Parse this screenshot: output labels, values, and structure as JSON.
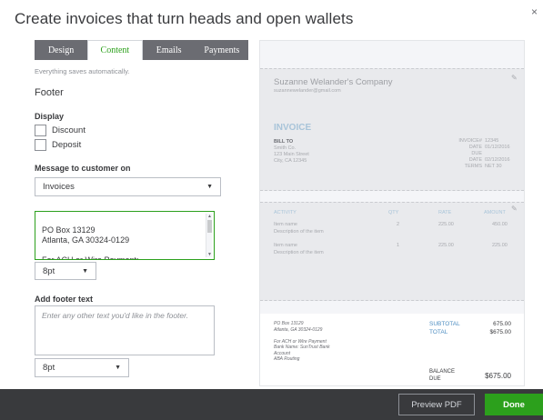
{
  "page_title": "Create invoices that turn heads and open wallets",
  "close_glyph": "×",
  "tabs": [
    {
      "label": "Design"
    },
    {
      "label": "Content"
    },
    {
      "label": "Emails"
    },
    {
      "label": "Payments"
    }
  ],
  "autosave_note": "Everything saves automatically.",
  "section_title": "Footer",
  "display": {
    "label": "Display",
    "options": [
      {
        "label": "Discount",
        "checked": false
      },
      {
        "label": "Deposit",
        "checked": false
      }
    ]
  },
  "message": {
    "label": "Message to customer on",
    "selected": "Invoices",
    "text": "PO Box 13129\nAtlanta, GA 30324-0129\n\nFor ACH or Wire Payment:\nBank Name: SunTrust Bank",
    "font_size": "8pt"
  },
  "footer": {
    "label": "Add footer text",
    "placeholder": "Enter any other text you'd like in the footer.",
    "font_size": "8pt"
  },
  "preview": {
    "company_name": "Suzanne Welander's Company",
    "company_email": "suzannewelander@gmail.com",
    "invoice_title": "INVOICE",
    "bill_to_label": "BILL TO",
    "bill_to_address": "Smith Co.\n123 Main Street\nCity, CA 12345",
    "meta_labels": "INVOICE#\nDATE\nDUE\nDATE\nTERMS",
    "meta_values": "12345\n01/12/2016\n\n02/12/2016\nNET 30",
    "columns": {
      "activity": "ACTIVITY",
      "qty": "QTY",
      "rate": "RATE",
      "amount": "AMOUNT"
    },
    "lines": [
      {
        "name": "Item name",
        "desc": "Description of the item",
        "qty": "2",
        "rate": "225.00",
        "amount": "450.00"
      },
      {
        "name": "Item name",
        "desc": "Description of the item",
        "qty": "1",
        "rate": "225.00",
        "amount": "225.00"
      }
    ],
    "footer_address": "PO Box 13129\nAtlanta, GA 30324-0129\n\nFor ACH or Wire Payment\nBank Name: SunTrust Bank\nAccount\nABA Routing",
    "subtotal_label": "SUBTOTAL",
    "subtotal_value": "675.00",
    "total_label": "TOTAL",
    "total_value": "$675.00",
    "balance_label": "BALANCE\nDUE",
    "balance_value": "$675.00"
  },
  "buttons": {
    "preview_pdf": "Preview PDF",
    "done": "Done"
  },
  "colors": {
    "accent_green": "#2ca01c",
    "tab_bar": "#6b6c72",
    "bottom_bar": "#393a3d"
  }
}
